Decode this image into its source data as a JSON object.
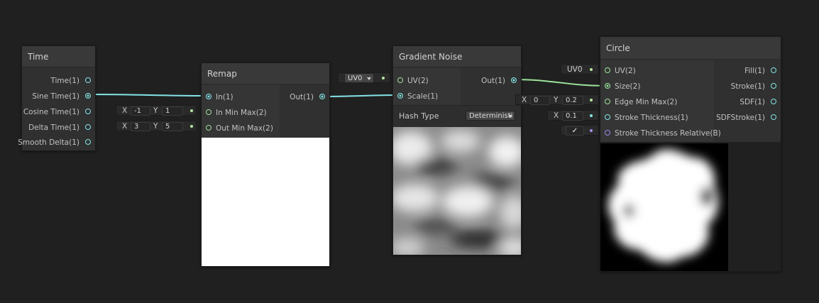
{
  "colors": {
    "canvas": "#202020",
    "node_bg": "#303030",
    "wire_float": "#84e4e7",
    "wire_vec2": "#9be49b",
    "bool": "#9a86e8"
  },
  "time_node": {
    "title": "Time",
    "outputs": [
      "Time(1)",
      "Sine Time(1)",
      "Cosine Time(1)",
      "Delta Time(1)",
      "Smooth Delta(1)"
    ]
  },
  "remap_node": {
    "title": "Remap",
    "inputs": [
      "In(1)",
      "In Min Max(2)",
      "Out Min Max(2)"
    ],
    "outputs": [
      "Out(1)"
    ],
    "in_min_max": {
      "x_label": "X",
      "x": "-1",
      "y_label": "Y",
      "y": "1"
    },
    "out_min_max": {
      "x_label": "X",
      "x": "3",
      "y_label": "Y",
      "y": "5"
    }
  },
  "noise_node": {
    "title": "Gradient Noise",
    "inputs": [
      "UV(2)",
      "Scale(1)"
    ],
    "outputs": [
      "Out(1)"
    ],
    "uv_dropdown": "UV0",
    "hash_type_label": "Hash Type",
    "hash_type_value": "Deterministi"
  },
  "circle_node": {
    "title": "Circle",
    "inputs": [
      "UV(2)",
      "Size(2)",
      "Edge Min Max(2)",
      "Stroke Thickness(1)",
      "Stroke Thickness Relative(B)"
    ],
    "outputs": [
      "Fill(1)",
      "Stroke(1)",
      "SDF(1)",
      "SDFStroke(1)"
    ],
    "uv_value": "UV0",
    "edge_min_max": {
      "x_label": "X",
      "x": "0",
      "y_label": "Y",
      "y": "0.2"
    },
    "stroke_thickness": {
      "x_label": "X",
      "x": "0.1"
    },
    "stroke_relative_checked": "✓"
  }
}
